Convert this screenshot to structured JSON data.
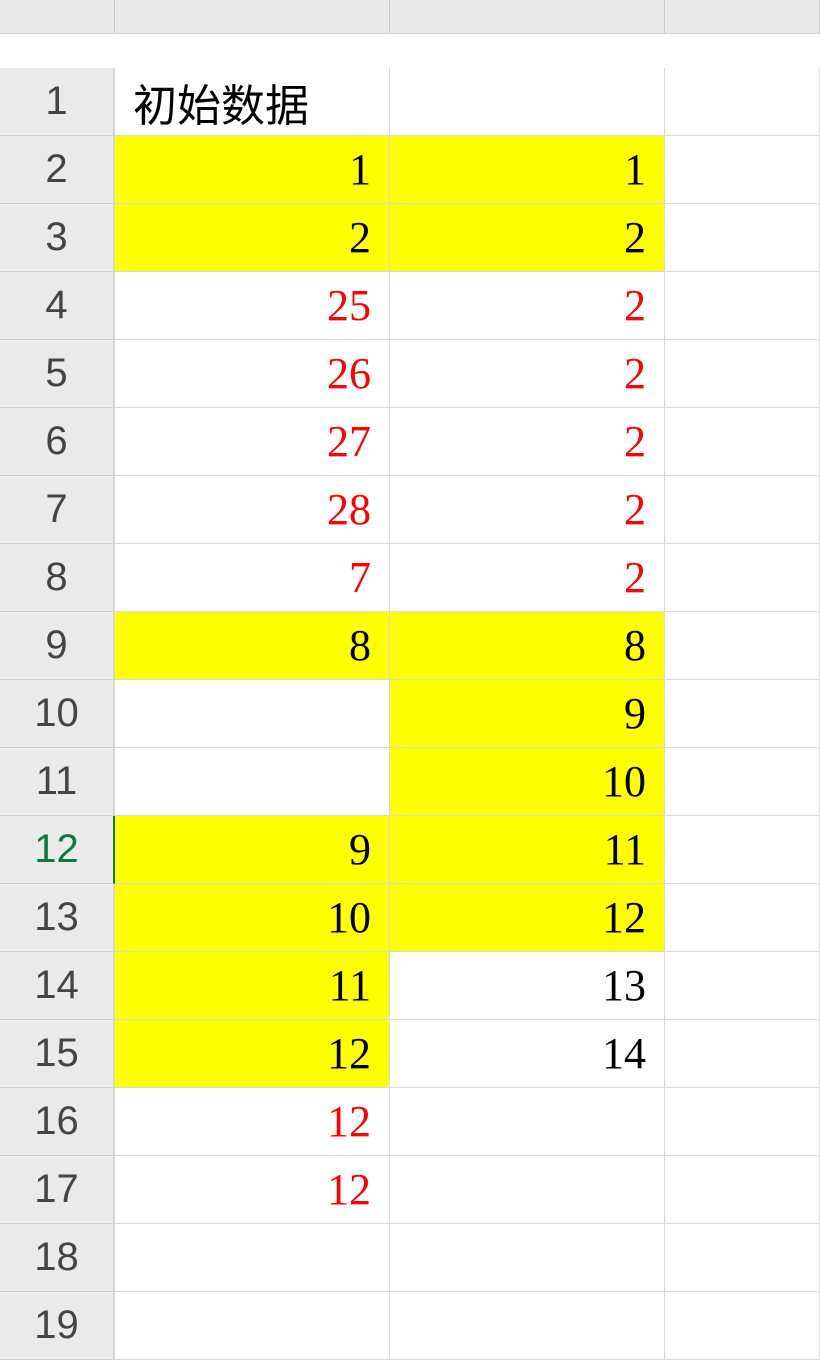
{
  "colHeaders": [
    "",
    "",
    "",
    ""
  ],
  "rows": [
    {
      "n": "1",
      "selected": false,
      "a": {
        "v": "初始数据",
        "hl": false,
        "red": false,
        "txt": true
      },
      "b": {
        "v": "",
        "hl": false,
        "red": false
      },
      "c": {
        "v": "",
        "hl": false,
        "red": false
      }
    },
    {
      "n": "2",
      "selected": false,
      "a": {
        "v": "1",
        "hl": true,
        "red": false
      },
      "b": {
        "v": "1",
        "hl": true,
        "red": false
      },
      "c": {
        "v": "",
        "hl": false,
        "red": false
      }
    },
    {
      "n": "3",
      "selected": false,
      "a": {
        "v": "2",
        "hl": true,
        "red": false
      },
      "b": {
        "v": "2",
        "hl": true,
        "red": false
      },
      "c": {
        "v": "",
        "hl": false,
        "red": false
      }
    },
    {
      "n": "4",
      "selected": false,
      "a": {
        "v": "25",
        "hl": false,
        "red": true
      },
      "b": {
        "v": "2",
        "hl": false,
        "red": true
      },
      "c": {
        "v": "",
        "hl": false,
        "red": false
      }
    },
    {
      "n": "5",
      "selected": false,
      "a": {
        "v": "26",
        "hl": false,
        "red": true
      },
      "b": {
        "v": "2",
        "hl": false,
        "red": true
      },
      "c": {
        "v": "",
        "hl": false,
        "red": false
      }
    },
    {
      "n": "6",
      "selected": false,
      "a": {
        "v": "27",
        "hl": false,
        "red": true
      },
      "b": {
        "v": "2",
        "hl": false,
        "red": true
      },
      "c": {
        "v": "",
        "hl": false,
        "red": false
      }
    },
    {
      "n": "7",
      "selected": false,
      "a": {
        "v": "28",
        "hl": false,
        "red": true
      },
      "b": {
        "v": "2",
        "hl": false,
        "red": true
      },
      "c": {
        "v": "",
        "hl": false,
        "red": false
      }
    },
    {
      "n": "8",
      "selected": false,
      "a": {
        "v": "7",
        "hl": false,
        "red": true
      },
      "b": {
        "v": "2",
        "hl": false,
        "red": true
      },
      "c": {
        "v": "",
        "hl": false,
        "red": false
      }
    },
    {
      "n": "9",
      "selected": false,
      "a": {
        "v": "8",
        "hl": true,
        "red": false
      },
      "b": {
        "v": "8",
        "hl": true,
        "red": false
      },
      "c": {
        "v": "",
        "hl": false,
        "red": false
      }
    },
    {
      "n": "10",
      "selected": false,
      "a": {
        "v": "",
        "hl": false,
        "red": false
      },
      "b": {
        "v": "9",
        "hl": true,
        "red": false
      },
      "c": {
        "v": "",
        "hl": false,
        "red": false
      }
    },
    {
      "n": "11",
      "selected": false,
      "a": {
        "v": "",
        "hl": false,
        "red": false
      },
      "b": {
        "v": "10",
        "hl": true,
        "red": false
      },
      "c": {
        "v": "",
        "hl": false,
        "red": false
      }
    },
    {
      "n": "12",
      "selected": true,
      "a": {
        "v": "9",
        "hl": true,
        "red": false
      },
      "b": {
        "v": "11",
        "hl": true,
        "red": false
      },
      "c": {
        "v": "",
        "hl": false,
        "red": false
      }
    },
    {
      "n": "13",
      "selected": false,
      "a": {
        "v": "10",
        "hl": true,
        "red": false
      },
      "b": {
        "v": "12",
        "hl": true,
        "red": false
      },
      "c": {
        "v": "",
        "hl": false,
        "red": false
      }
    },
    {
      "n": "14",
      "selected": false,
      "a": {
        "v": "11",
        "hl": true,
        "red": false
      },
      "b": {
        "v": "13",
        "hl": false,
        "red": false
      },
      "c": {
        "v": "",
        "hl": false,
        "red": false
      }
    },
    {
      "n": "15",
      "selected": false,
      "a": {
        "v": "12",
        "hl": true,
        "red": false
      },
      "b": {
        "v": "14",
        "hl": false,
        "red": false
      },
      "c": {
        "v": "",
        "hl": false,
        "red": false
      }
    },
    {
      "n": "16",
      "selected": false,
      "a": {
        "v": "12",
        "hl": false,
        "red": true
      },
      "b": {
        "v": "",
        "hl": false,
        "red": false
      },
      "c": {
        "v": "",
        "hl": false,
        "red": false
      }
    },
    {
      "n": "17",
      "selected": false,
      "a": {
        "v": "12",
        "hl": false,
        "red": true
      },
      "b": {
        "v": "",
        "hl": false,
        "red": false
      },
      "c": {
        "v": "",
        "hl": false,
        "red": false
      }
    },
    {
      "n": "18",
      "selected": false,
      "a": {
        "v": "",
        "hl": false,
        "red": false
      },
      "b": {
        "v": "",
        "hl": false,
        "red": false
      },
      "c": {
        "v": "",
        "hl": false,
        "red": false
      }
    },
    {
      "n": "19",
      "selected": false,
      "a": {
        "v": "",
        "hl": false,
        "red": false
      },
      "b": {
        "v": "",
        "hl": false,
        "red": false
      },
      "c": {
        "v": "",
        "hl": false,
        "red": false
      }
    }
  ]
}
